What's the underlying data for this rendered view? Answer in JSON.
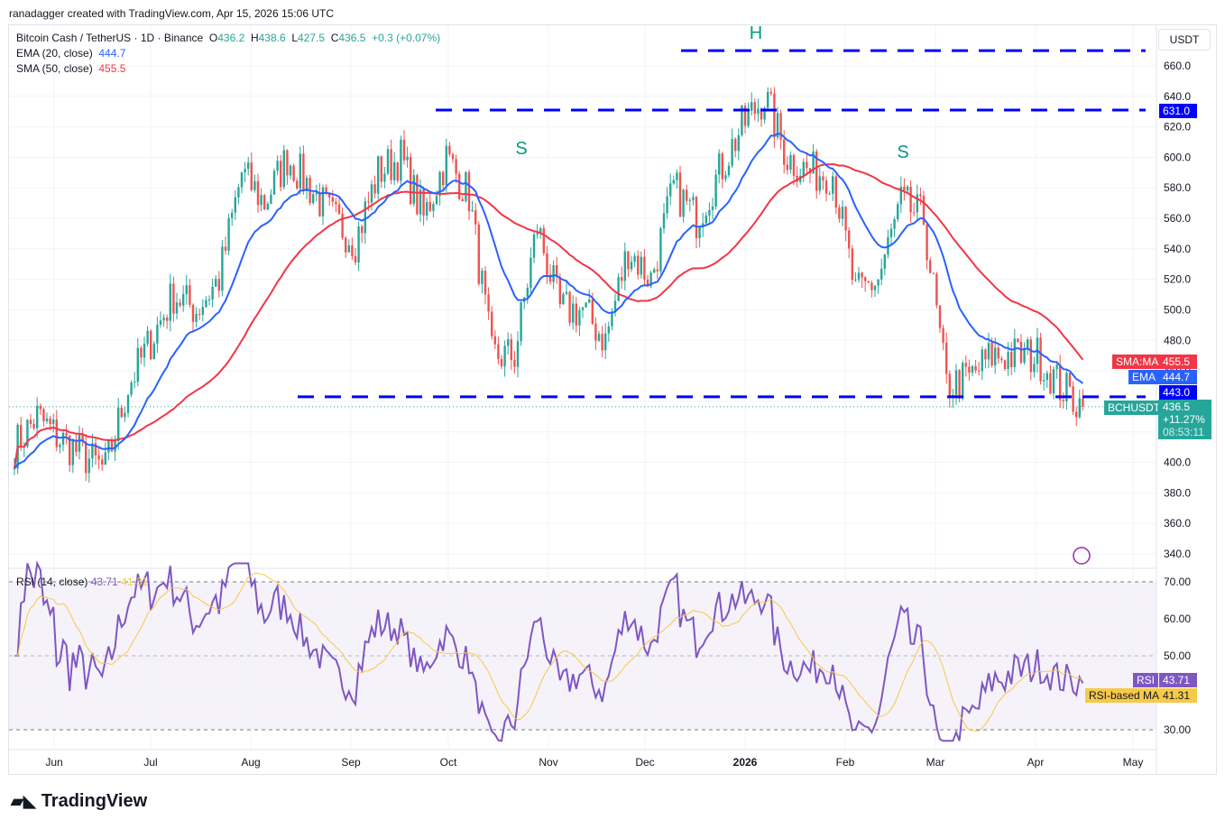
{
  "credit": "ranadagger created with TradingView.com, Apr 15, 2026 15:06 UTC",
  "symbol": {
    "name": "Bitcoin Cash / TetherUS · 1D · Binance",
    "o_label": "O",
    "o": "436.2",
    "h_label": "H",
    "h": "438.6",
    "l_label": "L",
    "l": "427.5",
    "c_label": "C",
    "c": "436.5",
    "change": "+0.3 (+0.07%)"
  },
  "ema": {
    "label": "EMA (20, close)",
    "value": "444.7",
    "tag": "EMA"
  },
  "sma": {
    "label": "SMA (50, close)",
    "value": "455.5",
    "tag": "SMA:MA"
  },
  "rsi": {
    "label": "RSI (14, close)",
    "value": "43.71",
    "ma_value": "41.31",
    "tag": "RSI",
    "ma_tag": "RSI-based MA"
  },
  "price_tag": {
    "symbol": "BCHUSDT",
    "price": "436.5",
    "change": "+11.27%",
    "countdown": "08:53:11"
  },
  "level_tags": {
    "resistance": "631.0",
    "support": "443.0"
  },
  "currency": "USDT",
  "annotations": [
    "H",
    "S",
    "S"
  ],
  "brand": "TradingView",
  "colors": {
    "up": "#26a69a",
    "down": "#ef5350",
    "ema": "#2962ff",
    "sma": "#f23645",
    "rsi": "#7e57c2",
    "rsi_ma": "#f7c948",
    "levels": "#0000ff"
  },
  "chart_data": {
    "type": "candlestick",
    "interval": "1D",
    "x_ticks": [
      "Jun",
      "Jul",
      "Aug",
      "Sep",
      "Oct",
      "Nov",
      "Dec",
      "2026",
      "Feb",
      "Mar",
      "Apr",
      "May"
    ],
    "y_ticks": [
      "340.0",
      "360.0",
      "380.0",
      "400.0",
      "420.0",
      "440.0",
      "460.0",
      "480.0",
      "500.0",
      "520.0",
      "540.0",
      "560.0",
      "580.0",
      "600.0",
      "620.0",
      "640.0",
      "660.0"
    ],
    "ylim": [
      330,
      680
    ],
    "rsi_ticks": [
      "30.00",
      "40.00",
      "50.00",
      "60.00",
      "70.00"
    ],
    "weekly_closes": {
      "start": "2025-05-18",
      "values": [
        410,
        430,
        415,
        405,
        395,
        450,
        480,
        510,
        500,
        520,
        590,
        570,
        600,
        580,
        560,
        545,
        590,
        600,
        560,
        600,
        575,
        470,
        470,
        555,
        500,
        500,
        480,
        540,
        520,
        580,
        560,
        590,
        620,
        640,
        600,
        590,
        590,
        510,
        520,
        570,
        560,
        450,
        455,
        470,
        470,
        470,
        450,
        436.5
      ]
    },
    "levels": [
      {
        "value": 670,
        "label": "H"
      },
      {
        "value": 631,
        "label": ""
      },
      {
        "value": 443,
        "label": ""
      }
    ]
  }
}
